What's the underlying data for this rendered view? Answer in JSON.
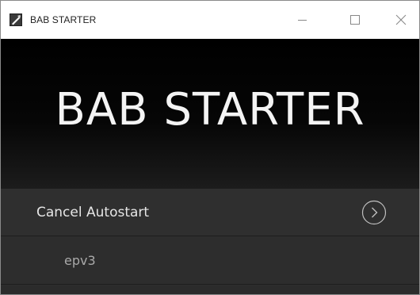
{
  "window": {
    "title": "BAB STARTER",
    "controls": {
      "minimize_icon": "minimize-icon",
      "maximize_icon": "maximize-icon",
      "close_icon": "close-icon"
    }
  },
  "banner": {
    "title": "BAB STARTER"
  },
  "list": {
    "items": [
      {
        "label": "Cancel Autostart",
        "icon": "chevron-right-circle-icon"
      },
      {
        "label": "epv3"
      }
    ]
  },
  "colors": {
    "titlebar_bg": "#ffffff",
    "banner_bg": "#000000",
    "list_bg": "#2d2d2d",
    "primary_text": "#e6e6e6",
    "secondary_text": "#a9a9a9"
  }
}
